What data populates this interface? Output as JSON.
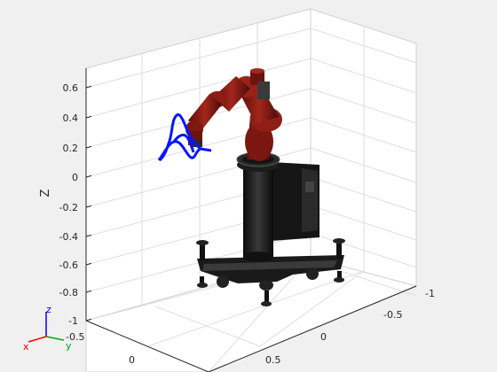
{
  "axes": {
    "zlabel": "Z",
    "z_ticks": [
      "0.6",
      "0.4",
      "0.2",
      "0",
      "-0.2",
      "-0.4",
      "-0.6",
      "-0.8",
      "-1"
    ],
    "x_ticks": [
      "-0.5",
      "0",
      "0.5"
    ],
    "y_ticks": [
      "-1",
      "-0.5",
      "0"
    ]
  },
  "triad": {
    "x": "x",
    "y": "y",
    "z": "z"
  },
  "colors": {
    "background": "#f0f0f0",
    "pane": "#ffffff",
    "grid": "#dcdcdc",
    "robot_red": "#8b1a14",
    "trajectory": "#0a14ff"
  },
  "scene": {
    "robot": "robot-arm-on-pedestal",
    "trajectory": "blue-3d-path"
  }
}
